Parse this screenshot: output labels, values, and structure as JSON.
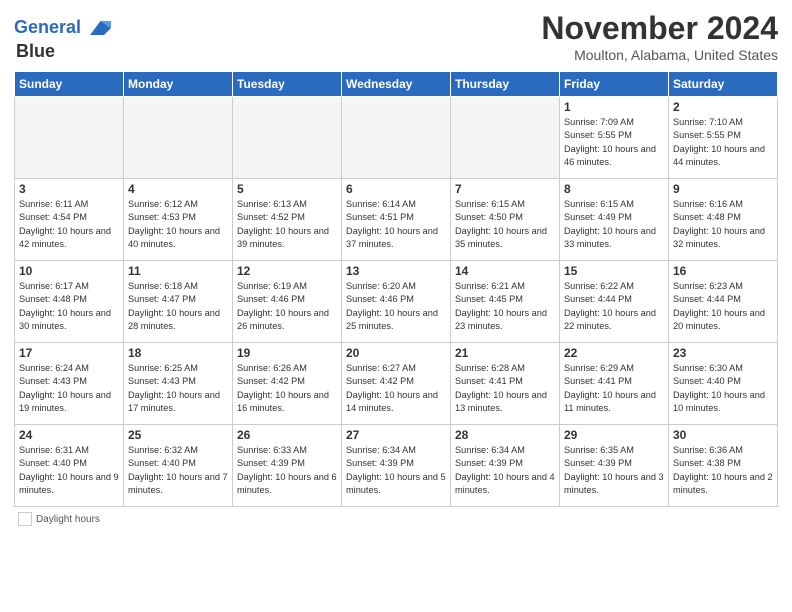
{
  "header": {
    "logo_line1": "General",
    "logo_line2": "Blue",
    "month_title": "November 2024",
    "location": "Moulton, Alabama, United States"
  },
  "days_of_week": [
    "Sunday",
    "Monday",
    "Tuesday",
    "Wednesday",
    "Thursday",
    "Friday",
    "Saturday"
  ],
  "weeks": [
    [
      {
        "day": "",
        "info": "",
        "empty": true
      },
      {
        "day": "",
        "info": "",
        "empty": true
      },
      {
        "day": "",
        "info": "",
        "empty": true
      },
      {
        "day": "",
        "info": "",
        "empty": true
      },
      {
        "day": "",
        "info": "",
        "empty": true
      },
      {
        "day": "1",
        "info": "Sunrise: 7:09 AM\nSunset: 5:55 PM\nDaylight: 10 hours and 46 minutes."
      },
      {
        "day": "2",
        "info": "Sunrise: 7:10 AM\nSunset: 5:55 PM\nDaylight: 10 hours and 44 minutes."
      }
    ],
    [
      {
        "day": "3",
        "info": "Sunrise: 6:11 AM\nSunset: 4:54 PM\nDaylight: 10 hours and 42 minutes."
      },
      {
        "day": "4",
        "info": "Sunrise: 6:12 AM\nSunset: 4:53 PM\nDaylight: 10 hours and 40 minutes."
      },
      {
        "day": "5",
        "info": "Sunrise: 6:13 AM\nSunset: 4:52 PM\nDaylight: 10 hours and 39 minutes."
      },
      {
        "day": "6",
        "info": "Sunrise: 6:14 AM\nSunset: 4:51 PM\nDaylight: 10 hours and 37 minutes."
      },
      {
        "day": "7",
        "info": "Sunrise: 6:15 AM\nSunset: 4:50 PM\nDaylight: 10 hours and 35 minutes."
      },
      {
        "day": "8",
        "info": "Sunrise: 6:15 AM\nSunset: 4:49 PM\nDaylight: 10 hours and 33 minutes."
      },
      {
        "day": "9",
        "info": "Sunrise: 6:16 AM\nSunset: 4:48 PM\nDaylight: 10 hours and 32 minutes."
      }
    ],
    [
      {
        "day": "10",
        "info": "Sunrise: 6:17 AM\nSunset: 4:48 PM\nDaylight: 10 hours and 30 minutes."
      },
      {
        "day": "11",
        "info": "Sunrise: 6:18 AM\nSunset: 4:47 PM\nDaylight: 10 hours and 28 minutes."
      },
      {
        "day": "12",
        "info": "Sunrise: 6:19 AM\nSunset: 4:46 PM\nDaylight: 10 hours and 26 minutes."
      },
      {
        "day": "13",
        "info": "Sunrise: 6:20 AM\nSunset: 4:46 PM\nDaylight: 10 hours and 25 minutes."
      },
      {
        "day": "14",
        "info": "Sunrise: 6:21 AM\nSunset: 4:45 PM\nDaylight: 10 hours and 23 minutes."
      },
      {
        "day": "15",
        "info": "Sunrise: 6:22 AM\nSunset: 4:44 PM\nDaylight: 10 hours and 22 minutes."
      },
      {
        "day": "16",
        "info": "Sunrise: 6:23 AM\nSunset: 4:44 PM\nDaylight: 10 hours and 20 minutes."
      }
    ],
    [
      {
        "day": "17",
        "info": "Sunrise: 6:24 AM\nSunset: 4:43 PM\nDaylight: 10 hours and 19 minutes."
      },
      {
        "day": "18",
        "info": "Sunrise: 6:25 AM\nSunset: 4:43 PM\nDaylight: 10 hours and 17 minutes."
      },
      {
        "day": "19",
        "info": "Sunrise: 6:26 AM\nSunset: 4:42 PM\nDaylight: 10 hours and 16 minutes."
      },
      {
        "day": "20",
        "info": "Sunrise: 6:27 AM\nSunset: 4:42 PM\nDaylight: 10 hours and 14 minutes."
      },
      {
        "day": "21",
        "info": "Sunrise: 6:28 AM\nSunset: 4:41 PM\nDaylight: 10 hours and 13 minutes."
      },
      {
        "day": "22",
        "info": "Sunrise: 6:29 AM\nSunset: 4:41 PM\nDaylight: 10 hours and 11 minutes."
      },
      {
        "day": "23",
        "info": "Sunrise: 6:30 AM\nSunset: 4:40 PM\nDaylight: 10 hours and 10 minutes."
      }
    ],
    [
      {
        "day": "24",
        "info": "Sunrise: 6:31 AM\nSunset: 4:40 PM\nDaylight: 10 hours and 9 minutes."
      },
      {
        "day": "25",
        "info": "Sunrise: 6:32 AM\nSunset: 4:40 PM\nDaylight: 10 hours and 7 minutes."
      },
      {
        "day": "26",
        "info": "Sunrise: 6:33 AM\nSunset: 4:39 PM\nDaylight: 10 hours and 6 minutes."
      },
      {
        "day": "27",
        "info": "Sunrise: 6:34 AM\nSunset: 4:39 PM\nDaylight: 10 hours and 5 minutes."
      },
      {
        "day": "28",
        "info": "Sunrise: 6:34 AM\nSunset: 4:39 PM\nDaylight: 10 hours and 4 minutes."
      },
      {
        "day": "29",
        "info": "Sunrise: 6:35 AM\nSunset: 4:39 PM\nDaylight: 10 hours and 3 minutes."
      },
      {
        "day": "30",
        "info": "Sunrise: 6:36 AM\nSunset: 4:38 PM\nDaylight: 10 hours and 2 minutes."
      }
    ]
  ],
  "legend": {
    "daylight_label": "Daylight hours"
  }
}
